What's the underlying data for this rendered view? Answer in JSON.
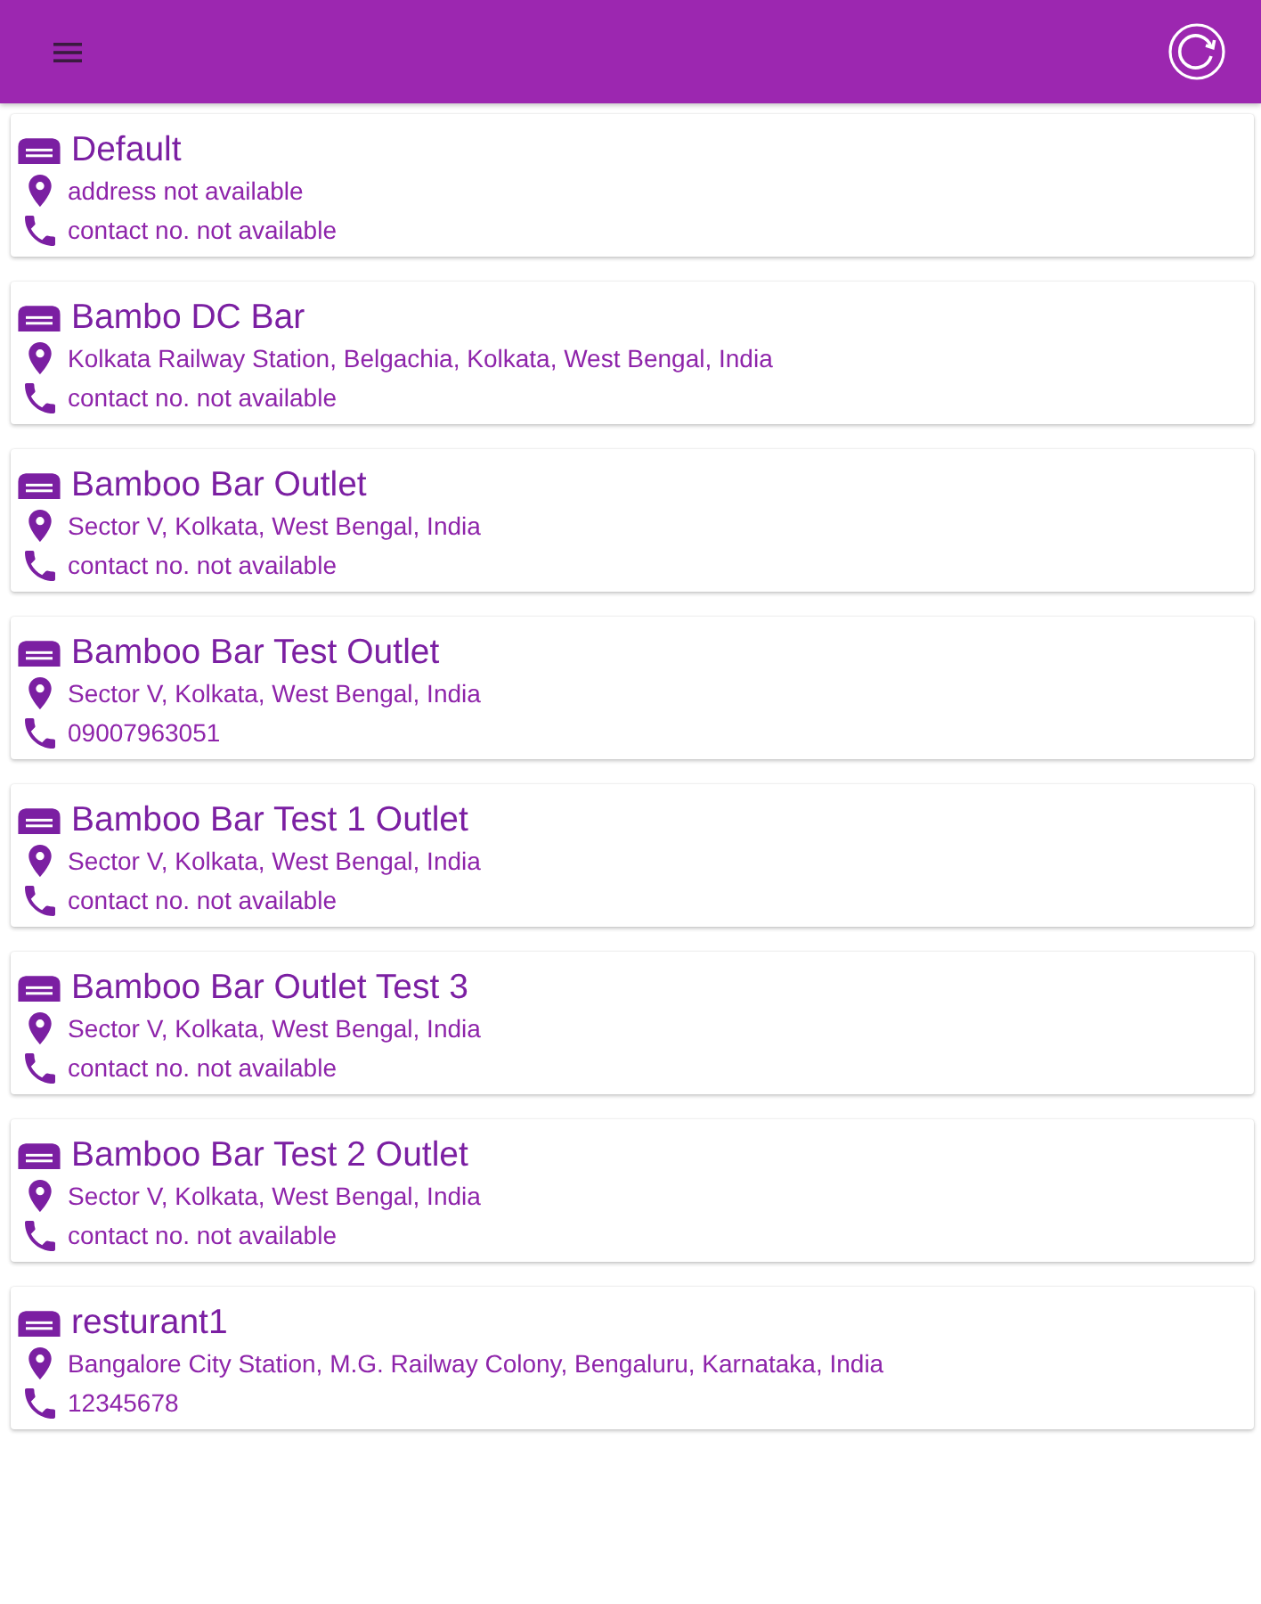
{
  "outlets": [
    {
      "name": "Default",
      "address": "address not available",
      "contact": "contact no. not available"
    },
    {
      "name": "Bambo DC Bar",
      "address": "Kolkata Railway Station, Belgachia, Kolkata, West Bengal, India",
      "contact": "contact no. not available"
    },
    {
      "name": "Bamboo Bar Outlet",
      "address": "Sector V, Kolkata, West Bengal, India",
      "contact": "contact no. not available"
    },
    {
      "name": "Bamboo Bar Test Outlet",
      "address": "Sector V, Kolkata, West Bengal, India",
      "contact": "09007963051"
    },
    {
      "name": "Bamboo Bar Test 1 Outlet",
      "address": "Sector V, Kolkata, West Bengal, India",
      "contact": "contact no. not available"
    },
    {
      "name": "Bamboo Bar Outlet Test 3",
      "address": "Sector V, Kolkata, West Bengal, India",
      "contact": "contact no. not available"
    },
    {
      "name": "Bamboo Bar Test 2 Outlet",
      "address": "Sector V, Kolkata, West Bengal, India",
      "contact": "contact no. not available"
    },
    {
      "name": "resturant1",
      "address": "Bangalore City Station, M.G. Railway Colony, Bengaluru, Karnataka, India",
      "contact": "12345678"
    }
  ]
}
